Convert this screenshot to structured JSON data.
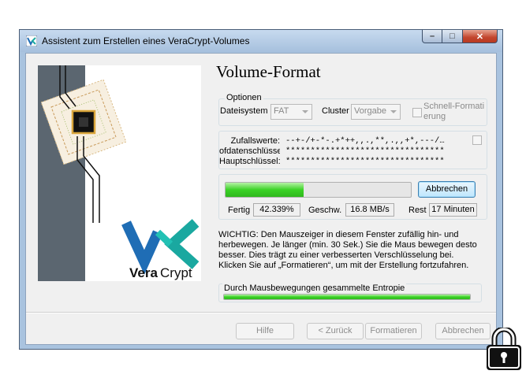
{
  "window": {
    "title": "Assistent zum Erstellen eines VeraCrypt-Volumes"
  },
  "caption_buttons": {
    "minimize": "–",
    "maximize": "□",
    "close": "✕"
  },
  "branding": {
    "logo_text_bold": "Vera",
    "logo_text_light": "Crypt"
  },
  "page": {
    "title": "Volume-Format"
  },
  "options": {
    "legend": "Optionen",
    "filesystem_label": "Dateisystem",
    "filesystem_value": "FAT",
    "cluster_label": "Cluster",
    "cluster_value": "Vorgabe",
    "quick_format_label_1": "Schnell-Formati",
    "quick_format_label_2": "erung"
  },
  "keys": {
    "random_label": "Zufallswerte:",
    "random_value": "--+-/+-*-.+*++,,.,**,.,,+*,---/…",
    "header_key_label": "ofdatenschlüssel:",
    "header_key_value": "********************************",
    "master_key_label": "Hauptschlüssel:",
    "master_key_value": "********************************"
  },
  "progress": {
    "fraction": 0.42339,
    "abort_label": "Abbrechen",
    "done_label": "Fertig",
    "done_value": "42.339%",
    "speed_label": "Geschw.",
    "speed_value": "16.8 MB/s",
    "left_label": "Rest",
    "left_value": "17 Minuten"
  },
  "info": {
    "text": "WICHTIG: Den Mauszeiger in diesem Fenster zufällig hin- und herbewegen. Je länger (min. 30 Sek.) Sie die Maus bewegen desto besser. Dies trägt zu einer verbesserten Verschlüsselung bei. Klicken Sie auf „Formatieren“, um mit der Erstellung fortzufahren."
  },
  "entropy": {
    "label": "Durch Mausbewegungen gesammelte Entropie",
    "fraction": 1.0
  },
  "footer": {
    "help": "Hilfe",
    "back": "< Zurück",
    "format": "Formatieren",
    "cancel": "Abbrechen"
  },
  "colors": {
    "progress_green": "#3bd226",
    "logo_teal": "#1aa8a0",
    "logo_blue": "#1f6db5"
  }
}
